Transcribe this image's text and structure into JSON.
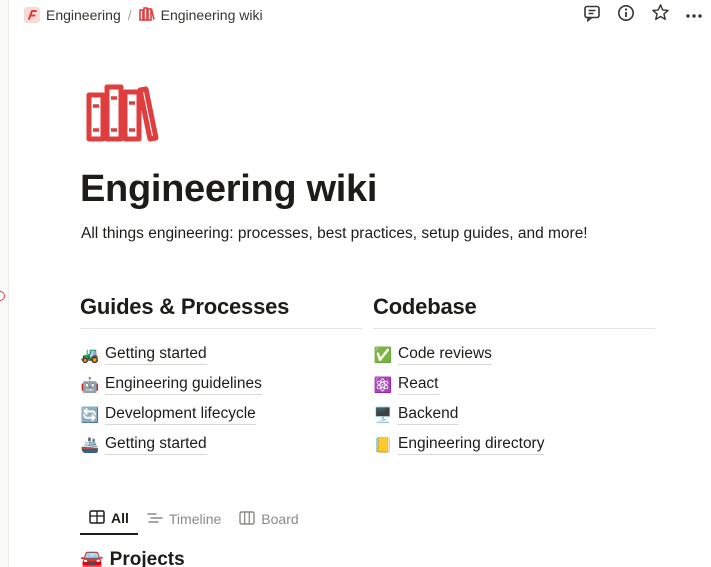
{
  "breadcrumb": {
    "workspace": "Engineering",
    "separator": "/",
    "page": "Engineering wiki"
  },
  "topbar": {
    "icons": [
      "comment-icon",
      "info-icon",
      "star-icon",
      "more-icon"
    ]
  },
  "page": {
    "icon": "books-icon",
    "title": "Engineering wiki",
    "description": "All things engineering: processes, best practices, setup guides, and more!"
  },
  "columns": [
    {
      "heading": "Guides & Processes",
      "items": [
        {
          "emoji": "🚜",
          "label": "Getting started"
        },
        {
          "emoji": "🤖",
          "label": "Engineering guidelines"
        },
        {
          "emoji": "🔄",
          "label": "Development lifecycle"
        },
        {
          "emoji": "🚢",
          "label": "Getting started"
        }
      ]
    },
    {
      "heading": "Codebase",
      "items": [
        {
          "emoji": "✅",
          "label": "Code reviews"
        },
        {
          "emoji": "⚛️",
          "label": "React"
        },
        {
          "emoji": "🖥️",
          "label": "Backend"
        },
        {
          "emoji": "📒",
          "label": "Engineering directory"
        }
      ]
    }
  ],
  "tabs": [
    {
      "label": "All",
      "active": true
    },
    {
      "label": "Timeline",
      "active": false
    },
    {
      "label": "Board",
      "active": false
    }
  ],
  "database": {
    "emoji": "🚘",
    "title": "Projects"
  },
  "colors": {
    "accent": "#e03e3e",
    "text": "#1d1c19",
    "muted": "#8b8a86"
  }
}
